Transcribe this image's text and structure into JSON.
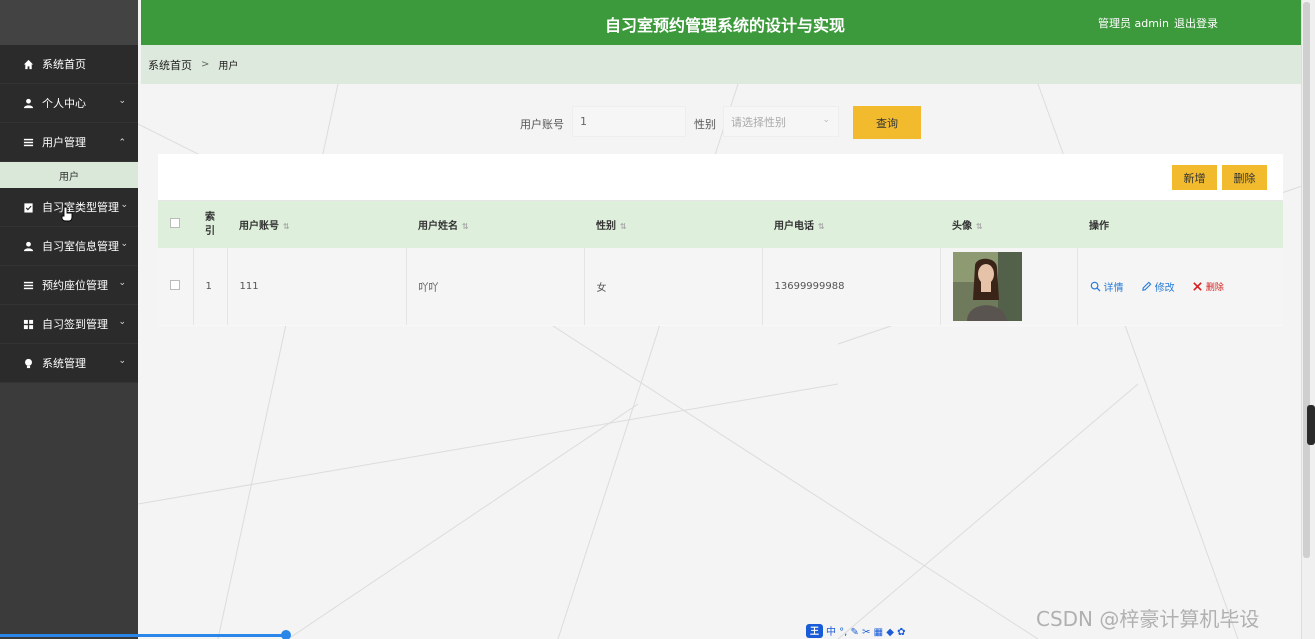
{
  "header": {
    "title": "自习室预约管理系统的设计与实现",
    "user_label": "管理员 admin",
    "logout": "退出登录"
  },
  "sidebar": {
    "items": [
      {
        "label": "系统首页",
        "icon": "home-icon",
        "chevron": ""
      },
      {
        "label": "个人中心",
        "icon": "user-icon",
        "chevron": "⌄"
      },
      {
        "label": "用户管理",
        "icon": "list-icon",
        "chevron": "⌃"
      },
      {
        "label": "自习室类型管理",
        "icon": "clipboard-icon",
        "chevron": "⌄"
      },
      {
        "label": "自习室信息管理",
        "icon": "user-icon",
        "chevron": "⌄"
      },
      {
        "label": "预约座位管理",
        "icon": "list-icon",
        "chevron": "⌄"
      },
      {
        "label": "自习签到管理",
        "icon": "grid-icon",
        "chevron": "⌄"
      },
      {
        "label": "系统管理",
        "icon": "bulb-icon",
        "chevron": "⌄"
      }
    ],
    "sub_item": "用户"
  },
  "breadcrumb": {
    "home": "系统首页",
    "separator": ">",
    "current": "用户"
  },
  "search": {
    "account_label": "用户账号",
    "account_value": "1",
    "gender_label": "性别",
    "gender_placeholder": "请选择性别",
    "query_button": "查询"
  },
  "actions": {
    "add": "新增",
    "delete": "删除"
  },
  "table": {
    "columns": [
      "索引",
      "用户账号",
      "用户姓名",
      "性别",
      "用户电话",
      "头像",
      "操作"
    ],
    "index_header_line1": "索",
    "index_header_line2": "引",
    "rows": [
      {
        "index": "1",
        "account": "111",
        "name": "吖吖",
        "gender": "女",
        "phone": "13699999988"
      }
    ],
    "ops": {
      "detail": "详情",
      "edit": "修改",
      "delete": "删除"
    }
  },
  "ime_bar": {
    "logo": "王",
    "text": "中 °, ✎ ✂ ▦ ◆ ✿"
  },
  "watermark": "CSDN @梓豪计算机毕设",
  "colors": {
    "header_green": "#3c9a3c",
    "sidebar_dark": "#2b2b2b",
    "button_yellow": "#f2bb2e",
    "table_head": "#def0dc"
  }
}
